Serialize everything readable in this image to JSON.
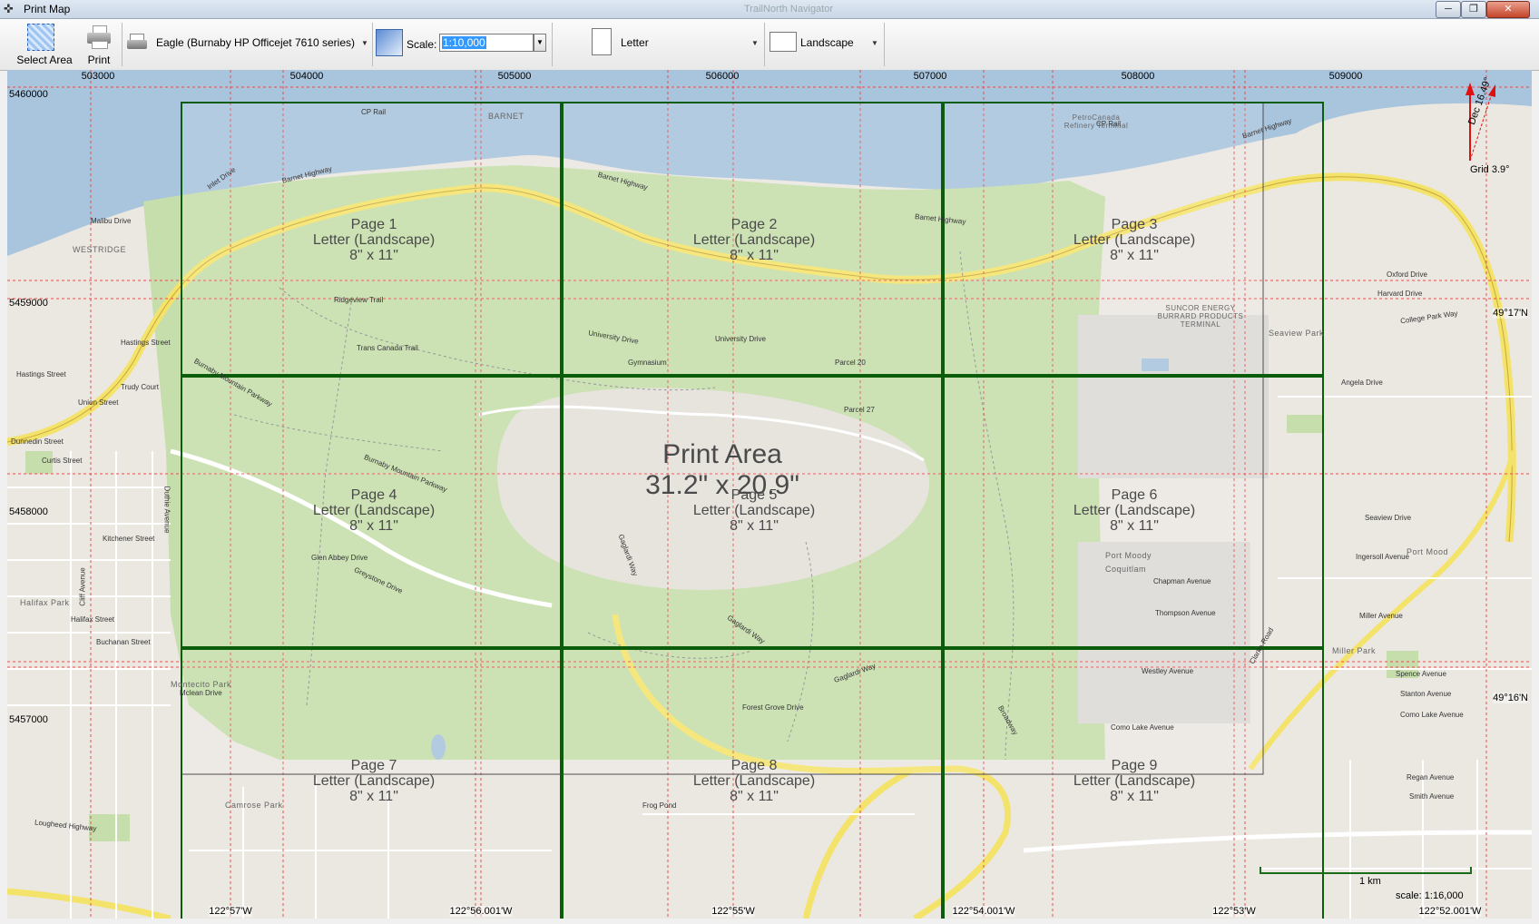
{
  "window": {
    "title": "Print Map",
    "background_title": "TrailNorth Navigator",
    "minimize": "─",
    "maximize": "❐",
    "close": "✕"
  },
  "toolbar": {
    "select_area_label": "Select Area",
    "print_label": "Print",
    "printer_name": "Eagle (Burnaby HP Officejet 7610 series)",
    "scale_label": "Scale:",
    "scale_value": "1:10,000",
    "paper_size": "Letter",
    "orientation": "Landscape"
  },
  "map": {
    "eastings": [
      "503000",
      "504000",
      "505000",
      "506000",
      "507000",
      "508000",
      "509000"
    ],
    "northings": [
      "5460000",
      "5459000",
      "5458000",
      "5457000"
    ],
    "longitudes": [
      "122°57'W",
      "122°56.001'W",
      "122°55'W",
      "122°54.001'W",
      "122°53'W",
      "122°52.001'W"
    ],
    "latitudes": [
      "49°17'N",
      "49°16'N"
    ],
    "pages": [
      {
        "title": "Page 1",
        "format": "Letter (Landscape)",
        "size": "8\" x 11\""
      },
      {
        "title": "Page 2",
        "format": "Letter (Landscape)",
        "size": "8\" x 11\""
      },
      {
        "title": "Page 3",
        "format": "Letter (Landscape)",
        "size": "8\" x 11\""
      },
      {
        "title": "Page 4",
        "format": "Letter (Landscape)",
        "size": "8\" x 11\""
      },
      {
        "title": "Page 5",
        "format": "Letter (Landscape)",
        "size": "8\" x 11\""
      },
      {
        "title": "Page 6",
        "format": "Letter (Landscape)",
        "size": "8\" x 11\""
      },
      {
        "title": "Page 7",
        "format": "Letter (Landscape)",
        "size": "8\" x 11\""
      },
      {
        "title": "Page 8",
        "format": "Letter (Landscape)",
        "size": "8\" x 11\""
      },
      {
        "title": "Page 9",
        "format": "Letter (Landscape)",
        "size": "8\" x 11\""
      }
    ],
    "print_area": {
      "title": "Print Area",
      "size": "31.2\" x 20.9\""
    },
    "declination": "Dec 16.49°",
    "grid_convergence": "Grid 3.9°",
    "scalebar_label": "1 km",
    "scale_text": "scale: 1:16,000",
    "streets": [
      "Barnet Highway",
      "Inlet Drive",
      "Hastings Street",
      "Burnaby Mountain Parkway",
      "University Drive",
      "Gaglardi Way",
      "Como Lake Avenue",
      "Lougheed Highway",
      "Broadway",
      "Curtis Street",
      "Union Street",
      "Halifax Street",
      "Kitchener Street",
      "Forest Grove Drive",
      "Harvard Drive",
      "Oxford Drive",
      "College Park Way",
      "Spence Avenue",
      "Stanton Avenue",
      "Smith Avenue",
      "Ridgeview Trail",
      "Trans Canada Trail",
      "Malibu Drive",
      "Trudy Court",
      "Duthie Avenue",
      "Cliff Avenue",
      "Dunnedin Street",
      "Buchanan Street",
      "Glen Abbey Drive",
      "Greystone Drive",
      "Mclean Drive",
      "Westley Avenue",
      "Clarke Road",
      "Miller Avenue",
      "Regan Avenue",
      "Thompson Avenue",
      "Chapman Avenue",
      "Ingersoll Avenue",
      "Seaview Drive",
      "Angela Drive",
      "CP Rail",
      "Frog Pond",
      "Parcel 20",
      "Parcel 27",
      "Gymnasium"
    ],
    "places": [
      "BARNET",
      "WESTRIDGE",
      "Halifax Park",
      "Montecito Park",
      "Camrose Park",
      "Seaview Park",
      "Port Moody",
      "Coquitlam",
      "SUNCOR ENERGY BURRARD PRODUCTS TERMINAL",
      "PetroCanada Refinery Terminal",
      "Miller Park",
      "Port Mood"
    ]
  },
  "colors": {
    "water": "#a9c4dd",
    "park": "#c5deab",
    "urban": "#ebe8e2",
    "highway": "#f4e36b",
    "page_border": "#0b5d0b",
    "grid_line": "#e05050"
  }
}
